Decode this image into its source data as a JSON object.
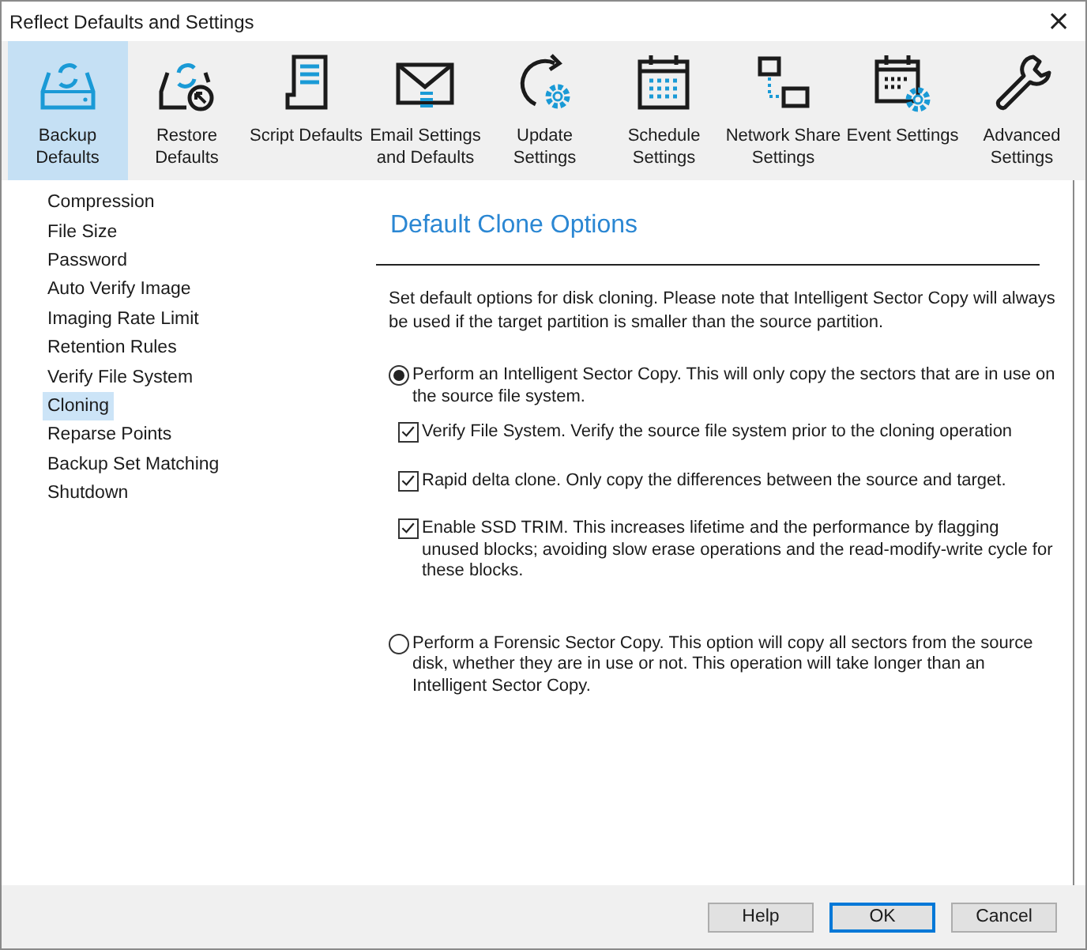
{
  "window": {
    "title": "Reflect Defaults and Settings",
    "close": "×"
  },
  "toolbar": [
    {
      "label": "Backup Defaults",
      "selected": true
    },
    {
      "label": "Restore Defaults",
      "selected": false
    },
    {
      "label": "Script Defaults",
      "selected": false
    },
    {
      "label": "Email Settings and Defaults",
      "selected": false
    },
    {
      "label": "Update Settings",
      "selected": false
    },
    {
      "label": "Schedule Settings",
      "selected": false
    },
    {
      "label": "Network Share Settings",
      "selected": false
    },
    {
      "label": "Event Settings",
      "selected": false
    },
    {
      "label": "Advanced Settings",
      "selected": false
    }
  ],
  "sidebar": {
    "items": [
      {
        "label": "Compression",
        "selected": false
      },
      {
        "label": "File Size",
        "selected": false
      },
      {
        "label": "Password",
        "selected": false
      },
      {
        "label": "Auto Verify Image",
        "selected": false
      },
      {
        "label": "Imaging Rate Limit",
        "selected": false
      },
      {
        "label": "Retention Rules",
        "selected": false
      },
      {
        "label": "Verify File System",
        "selected": false
      },
      {
        "label": "Cloning",
        "selected": true
      },
      {
        "label": "Reparse Points",
        "selected": false
      },
      {
        "label": "Backup Set Matching",
        "selected": false
      },
      {
        "label": "Shutdown",
        "selected": false
      }
    ]
  },
  "panel": {
    "heading": "Default Clone Options",
    "description": "Set default options for disk cloning.  Please note that Intelligent Sector Copy will always be used if the target partition is smaller than the source partition.",
    "options": [
      {
        "label": "Perform an Intelligent Sector Copy.  This will only copy the sectors that are in use on the source file system.",
        "selected": true,
        "suboptions": [
          {
            "label": "Verify File System.  Verify the source file system prior to the cloning operation",
            "checked": true
          },
          {
            "label": "Rapid delta clone.  Only copy the differences between the source and target.",
            "checked": true
          },
          {
            "label": "Enable SSD TRIM. This increases lifetime and the performance by flagging unused blocks; avoiding slow erase operations and the read-modify-write cycle for these blocks.",
            "checked": true
          }
        ]
      },
      {
        "label": "Perform a Forensic Sector Copy. This option will copy all sectors from the source disk, whether they are in use or not.  This operation will take longer than an Intelligent Sector Copy.",
        "selected": false
      }
    ]
  },
  "buttons": [
    {
      "label": "Help",
      "default": false
    },
    {
      "label": "OK",
      "default": true
    },
    {
      "label": "Cancel",
      "default": false
    }
  ]
}
